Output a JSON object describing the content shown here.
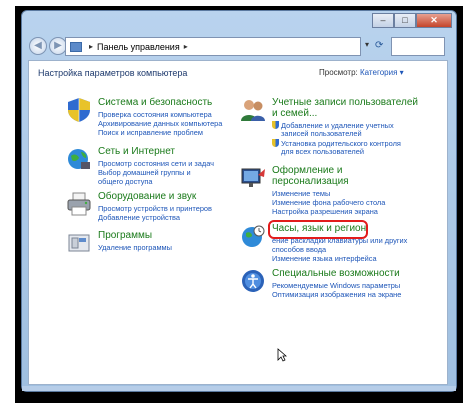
{
  "window": {
    "controls": {
      "minimize": "–",
      "maximize": "□",
      "close": "✕"
    }
  },
  "navbar": {
    "back_icon": "back-arrow-icon",
    "forward_icon": "forward-arrow-icon",
    "breadcrumb": "Панель управления",
    "search_placeholder": ""
  },
  "main": {
    "title": "Настройка параметров компьютера",
    "view_label": "Просмотр:",
    "view_value": "Категория"
  },
  "categories": [
    {
      "title": "Система и безопасность",
      "icon": "shield-security-icon",
      "links": [
        "Проверка состояния компьютера",
        "Архивирование данных компьютера",
        "Поиск и исправление проблем"
      ]
    },
    {
      "title": "Сеть и Интернет",
      "icon": "globe-network-icon",
      "links": [
        "Просмотр состояния сети и задач",
        "Выбор домашней группы и",
        "общего доступа"
      ]
    },
    {
      "title": "Оборудование и звук",
      "icon": "printer-icon",
      "links": [
        "Просмотр устройств и принтеров",
        "Добавление устройства"
      ]
    },
    {
      "title": "Программы",
      "icon": "programs-icon",
      "links": [
        "Удаление программы"
      ]
    },
    {
      "title": "Учетные записи пользователей",
      "title2": "и семей...",
      "icon": "users-icon",
      "links": [
        "Добавление и удаление учетных",
        "записей пользователей",
        "Установка родительского контроля",
        "для всех пользователей"
      ]
    },
    {
      "title": "Оформление и",
      "title2": "персонализация",
      "icon": "appearance-icon",
      "links": [
        "Изменение темы",
        "Изменение фона рабочего стола",
        "Настройка разрешения экрана"
      ]
    },
    {
      "title": "Часы, язык и регион",
      "icon": "clock-globe-icon",
      "links": [
        "ение раскладки клавиатуры или других",
        "способов ввода",
        "Изменение языка интерфейса"
      ]
    },
    {
      "title": "Специальные возможности",
      "icon": "accessibility-icon",
      "links": [
        "Рекомендуемые Windows параметры",
        "Оптимизация изображения на экране"
      ]
    }
  ]
}
